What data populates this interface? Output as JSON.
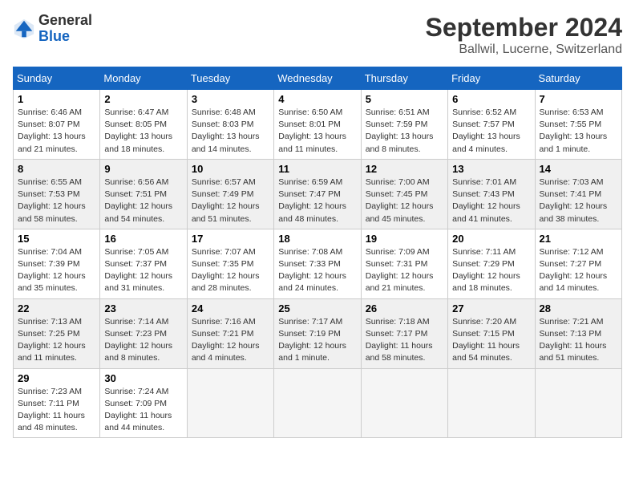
{
  "header": {
    "logo_general": "General",
    "logo_blue": "Blue",
    "month": "September 2024",
    "location": "Ballwil, Lucerne, Switzerland"
  },
  "weekdays": [
    "Sunday",
    "Monday",
    "Tuesday",
    "Wednesday",
    "Thursday",
    "Friday",
    "Saturday"
  ],
  "weeks": [
    [
      {
        "day": "1",
        "info": "Sunrise: 6:46 AM\nSunset: 8:07 PM\nDaylight: 13 hours\nand 21 minutes."
      },
      {
        "day": "2",
        "info": "Sunrise: 6:47 AM\nSunset: 8:05 PM\nDaylight: 13 hours\nand 18 minutes."
      },
      {
        "day": "3",
        "info": "Sunrise: 6:48 AM\nSunset: 8:03 PM\nDaylight: 13 hours\nand 14 minutes."
      },
      {
        "day": "4",
        "info": "Sunrise: 6:50 AM\nSunset: 8:01 PM\nDaylight: 13 hours\nand 11 minutes."
      },
      {
        "day": "5",
        "info": "Sunrise: 6:51 AM\nSunset: 7:59 PM\nDaylight: 13 hours\nand 8 minutes."
      },
      {
        "day": "6",
        "info": "Sunrise: 6:52 AM\nSunset: 7:57 PM\nDaylight: 13 hours\nand 4 minutes."
      },
      {
        "day": "7",
        "info": "Sunrise: 6:53 AM\nSunset: 7:55 PM\nDaylight: 13 hours\nand 1 minute."
      }
    ],
    [
      {
        "day": "8",
        "info": "Sunrise: 6:55 AM\nSunset: 7:53 PM\nDaylight: 12 hours\nand 58 minutes."
      },
      {
        "day": "9",
        "info": "Sunrise: 6:56 AM\nSunset: 7:51 PM\nDaylight: 12 hours\nand 54 minutes."
      },
      {
        "day": "10",
        "info": "Sunrise: 6:57 AM\nSunset: 7:49 PM\nDaylight: 12 hours\nand 51 minutes."
      },
      {
        "day": "11",
        "info": "Sunrise: 6:59 AM\nSunset: 7:47 PM\nDaylight: 12 hours\nand 48 minutes."
      },
      {
        "day": "12",
        "info": "Sunrise: 7:00 AM\nSunset: 7:45 PM\nDaylight: 12 hours\nand 45 minutes."
      },
      {
        "day": "13",
        "info": "Sunrise: 7:01 AM\nSunset: 7:43 PM\nDaylight: 12 hours\nand 41 minutes."
      },
      {
        "day": "14",
        "info": "Sunrise: 7:03 AM\nSunset: 7:41 PM\nDaylight: 12 hours\nand 38 minutes."
      }
    ],
    [
      {
        "day": "15",
        "info": "Sunrise: 7:04 AM\nSunset: 7:39 PM\nDaylight: 12 hours\nand 35 minutes."
      },
      {
        "day": "16",
        "info": "Sunrise: 7:05 AM\nSunset: 7:37 PM\nDaylight: 12 hours\nand 31 minutes."
      },
      {
        "day": "17",
        "info": "Sunrise: 7:07 AM\nSunset: 7:35 PM\nDaylight: 12 hours\nand 28 minutes."
      },
      {
        "day": "18",
        "info": "Sunrise: 7:08 AM\nSunset: 7:33 PM\nDaylight: 12 hours\nand 24 minutes."
      },
      {
        "day": "19",
        "info": "Sunrise: 7:09 AM\nSunset: 7:31 PM\nDaylight: 12 hours\nand 21 minutes."
      },
      {
        "day": "20",
        "info": "Sunrise: 7:11 AM\nSunset: 7:29 PM\nDaylight: 12 hours\nand 18 minutes."
      },
      {
        "day": "21",
        "info": "Sunrise: 7:12 AM\nSunset: 7:27 PM\nDaylight: 12 hours\nand 14 minutes."
      }
    ],
    [
      {
        "day": "22",
        "info": "Sunrise: 7:13 AM\nSunset: 7:25 PM\nDaylight: 12 hours\nand 11 minutes."
      },
      {
        "day": "23",
        "info": "Sunrise: 7:14 AM\nSunset: 7:23 PM\nDaylight: 12 hours\nand 8 minutes."
      },
      {
        "day": "24",
        "info": "Sunrise: 7:16 AM\nSunset: 7:21 PM\nDaylight: 12 hours\nand 4 minutes."
      },
      {
        "day": "25",
        "info": "Sunrise: 7:17 AM\nSunset: 7:19 PM\nDaylight: 12 hours\nand 1 minute."
      },
      {
        "day": "26",
        "info": "Sunrise: 7:18 AM\nSunset: 7:17 PM\nDaylight: 11 hours\nand 58 minutes."
      },
      {
        "day": "27",
        "info": "Sunrise: 7:20 AM\nSunset: 7:15 PM\nDaylight: 11 hours\nand 54 minutes."
      },
      {
        "day": "28",
        "info": "Sunrise: 7:21 AM\nSunset: 7:13 PM\nDaylight: 11 hours\nand 51 minutes."
      }
    ],
    [
      {
        "day": "29",
        "info": "Sunrise: 7:23 AM\nSunset: 7:11 PM\nDaylight: 11 hours\nand 48 minutes."
      },
      {
        "day": "30",
        "info": "Sunrise: 7:24 AM\nSunset: 7:09 PM\nDaylight: 11 hours\nand 44 minutes."
      },
      {
        "day": "",
        "info": ""
      },
      {
        "day": "",
        "info": ""
      },
      {
        "day": "",
        "info": ""
      },
      {
        "day": "",
        "info": ""
      },
      {
        "day": "",
        "info": ""
      }
    ]
  ]
}
